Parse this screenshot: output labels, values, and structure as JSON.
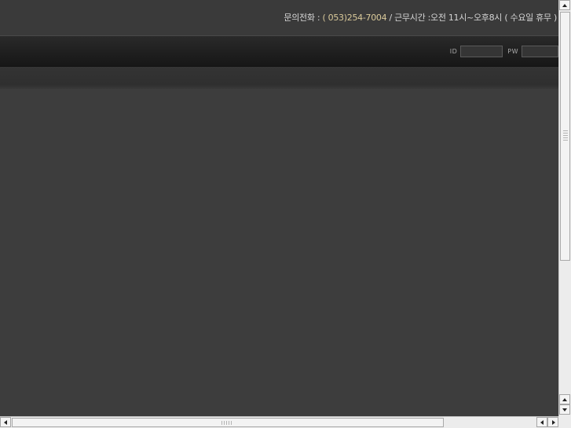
{
  "header": {
    "contact_label": "문의전화 : ",
    "phone": "( 053)254-7004",
    "hours": " / 근무시간 :오전 11시~오후8시 ( 수요일 휴무 )"
  },
  "login": {
    "id_label": "ID",
    "pw_label": "PW",
    "id_value": "",
    "pw_value": ""
  },
  "colors": {
    "background": "#3c3c3c",
    "nav_bar": "#1e1e1e",
    "phone_accent": "#d9c99a"
  }
}
